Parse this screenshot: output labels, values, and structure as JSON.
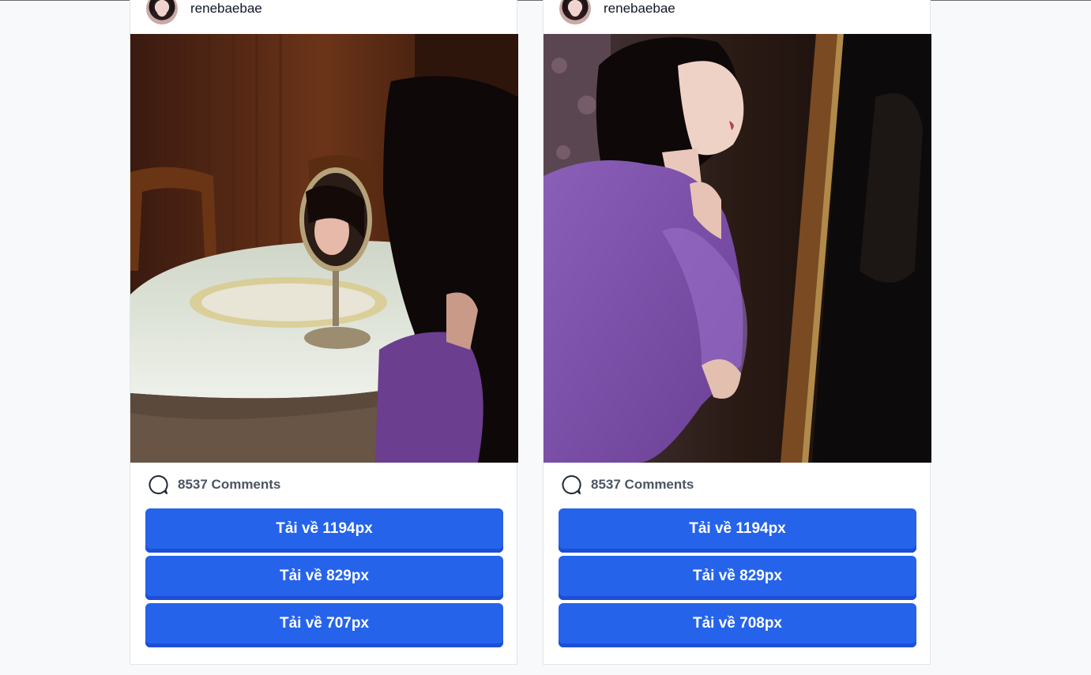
{
  "posts": [
    {
      "username": "renebaebae",
      "comments_label": "8537 Comments",
      "photo_alt": "woman with hand mirror on table",
      "downloads": [
        {
          "label": "Tải về 1194px"
        },
        {
          "label": "Tải về 829px"
        },
        {
          "label": "Tải về 707px"
        }
      ]
    },
    {
      "username": "renebaebae",
      "comments_label": "8537 Comments",
      "photo_alt": "woman in purple dress by mirror",
      "downloads": [
        {
          "label": "Tải về 1194px"
        },
        {
          "label": "Tải về 829px"
        },
        {
          "label": "Tải về 708px"
        }
      ]
    }
  ],
  "colors": {
    "button": "#2563eb",
    "button_shadow": "#1d4ed8",
    "page_bg": "#f8f9fb"
  },
  "icons": {
    "comment": "speech-bubble-icon"
  }
}
